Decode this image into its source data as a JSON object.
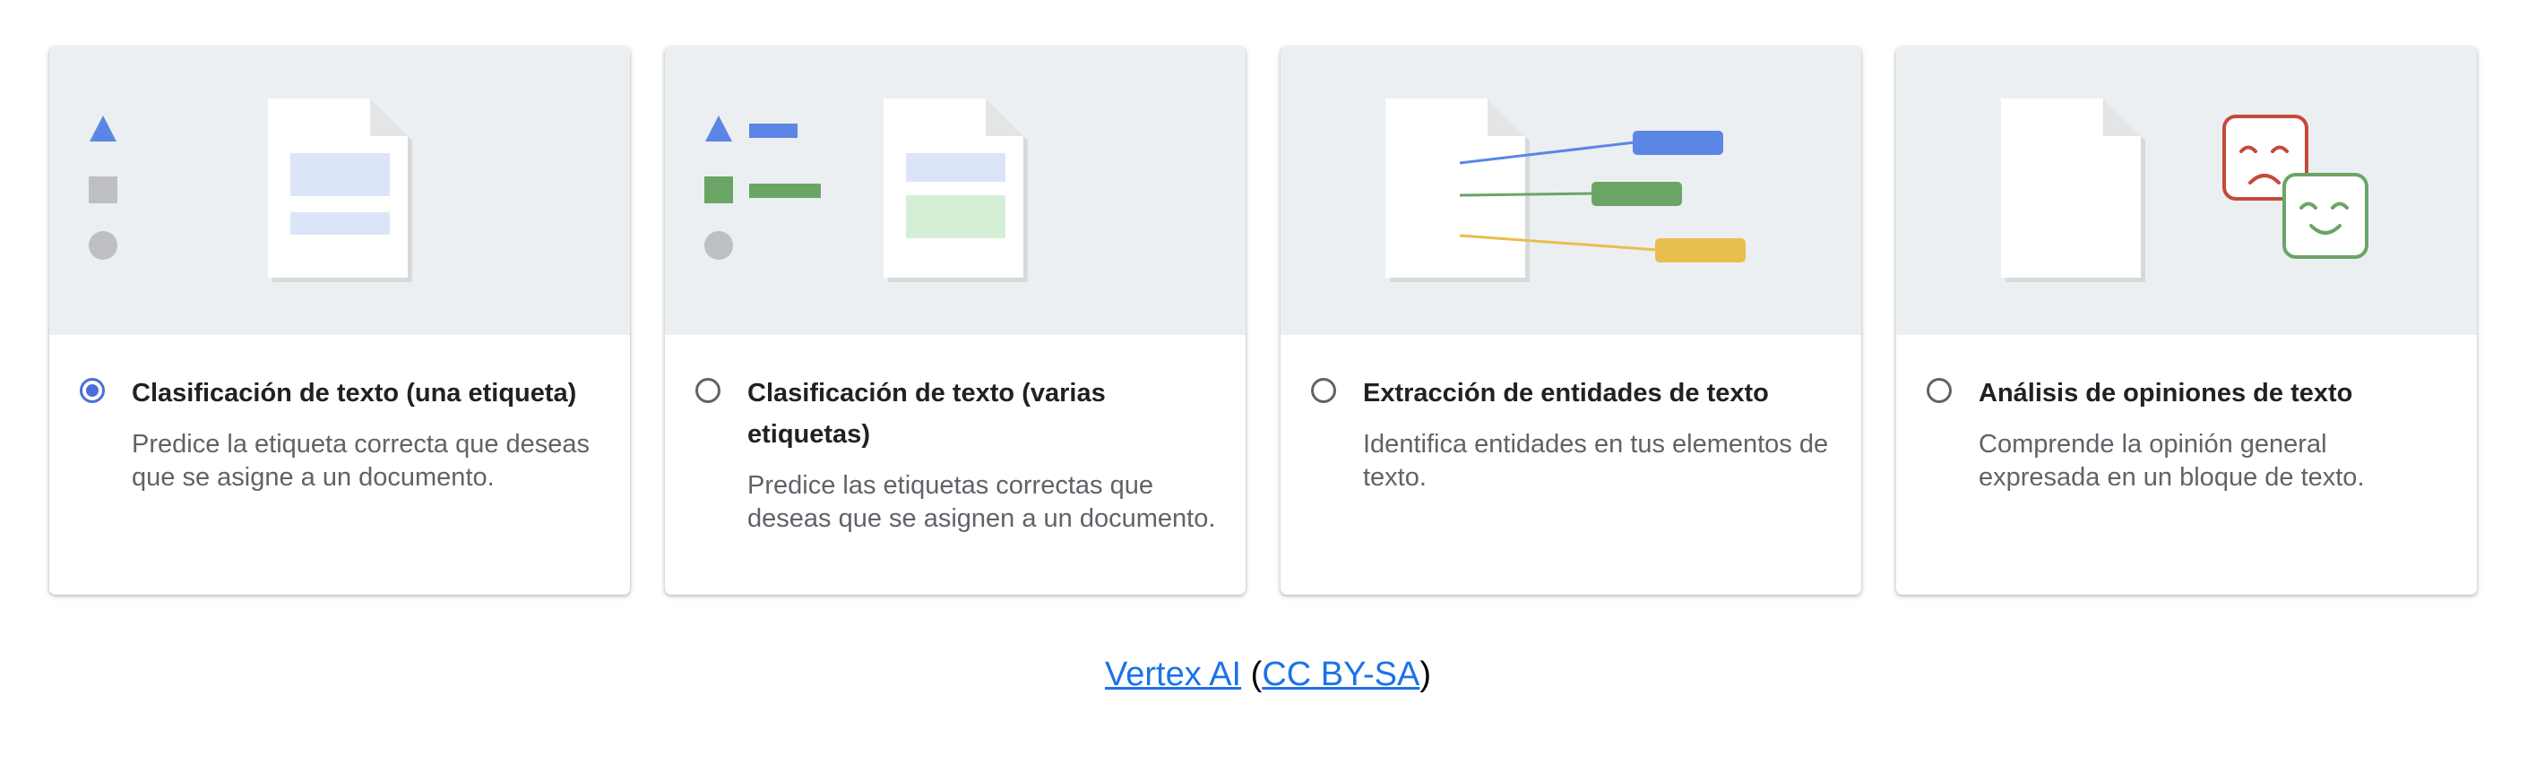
{
  "cards": [
    {
      "title": "Clasificación de texto (una etiqueta)",
      "description": "Predice la etiqueta correcta que deseas que se asigne a un documento.",
      "selected": true
    },
    {
      "title": "Clasificación de texto (varias etiquetas)",
      "description": "Predice las etiquetas correctas que deseas que se asignen a un documento.",
      "selected": false
    },
    {
      "title": "Extracción de entidades de texto",
      "description": "Identifica entidades en tus elementos de texto.",
      "selected": false
    },
    {
      "title": "Análisis de opiniones de texto",
      "description": "Comprende la opinión general expresada en un bloque de texto.",
      "selected": false
    }
  ],
  "footer": {
    "link1": "Vertex AI",
    "open_paren": "(",
    "link2": "CC BY-SA",
    "close_paren": ")"
  },
  "colors": {
    "accent": "#4a6fd6",
    "blue_tag": "#5b86e5",
    "green_tag": "#6aa566",
    "yellow_tag": "#e8be4f",
    "sad_face": "#c5493a",
    "happy_face": "#6aa566"
  }
}
